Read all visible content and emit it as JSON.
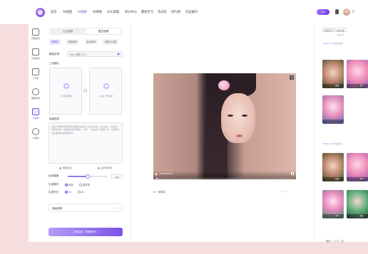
{
  "nav": {
    "items": [
      "首页",
      "AI绘图",
      "AI视频",
      "AI修图",
      "AI工具箱",
      "积分中心",
      "教程学习",
      "活动页",
      "排行榜",
      "作品展示"
    ],
    "active_index": 2,
    "vip_label": "VIP",
    "right_text": "Z"
  },
  "sidebar": {
    "items": [
      {
        "label": "智能模式"
      },
      {
        "label": "高级模式"
      },
      {
        "label": "工作流"
      },
      {
        "label": "图像修复"
      },
      {
        "label": "AI视频"
      },
      {
        "label": "AI音频"
      }
    ],
    "active_index": 4
  },
  "form": {
    "seg_tabs": [
      "文生视频",
      "图生视频"
    ],
    "seg_active": 1,
    "subtabs": [
      "首尾帧",
      "多图参考",
      "运动参考",
      "视频对口型"
    ],
    "subtab_active": 0,
    "model_label": "模型名称",
    "model_value": "Vidu 模型 V1.5",
    "upload_label": "上传图片",
    "upload_first": "上传首帧图片",
    "upload_last": "请先上传首帧",
    "prompt_label": "画面描述",
    "prompt_text": "请输入你想要生成视频的画面内容描述，如:主体动作、镜头运动、光影变化、情绪氛围等，越详细生成效果越好。示例：一位古风少女回眸一笑，花瓣飘落，镜头缓慢推进至面部特写。",
    "btn_random": "随机灵感",
    "btn_optimize": "提示词优化",
    "motion_label": "运动幅度",
    "motion_value": "0.50",
    "motion_fraction": 0.5,
    "mode_label": "生成模式",
    "mode_options": [
      "标准",
      "高质量"
    ],
    "mode_active": 0,
    "duration_label": "生成时长",
    "duration_options": [
      "4s",
      "8s"
    ],
    "duration_active": 0,
    "advanced_label": "高级参数",
    "generate_label": "立即生成（消耗积分）"
  },
  "preview": {
    "time": "00:00/00:05",
    "progress_fraction": 0.02,
    "caption": "一键同款",
    "actions": "⤓ ··· ♡"
  },
  "gallery": {
    "tabs": [
      "生成记录",
      "我的作品"
    ],
    "tab_active": 0,
    "top_note": "Recent",
    "section1": "2024-11-20 生成记录",
    "section2": "2024-11-19 生成记录",
    "badge": "视频",
    "pager": "首页 ‹ 1 2 3 › 共"
  }
}
